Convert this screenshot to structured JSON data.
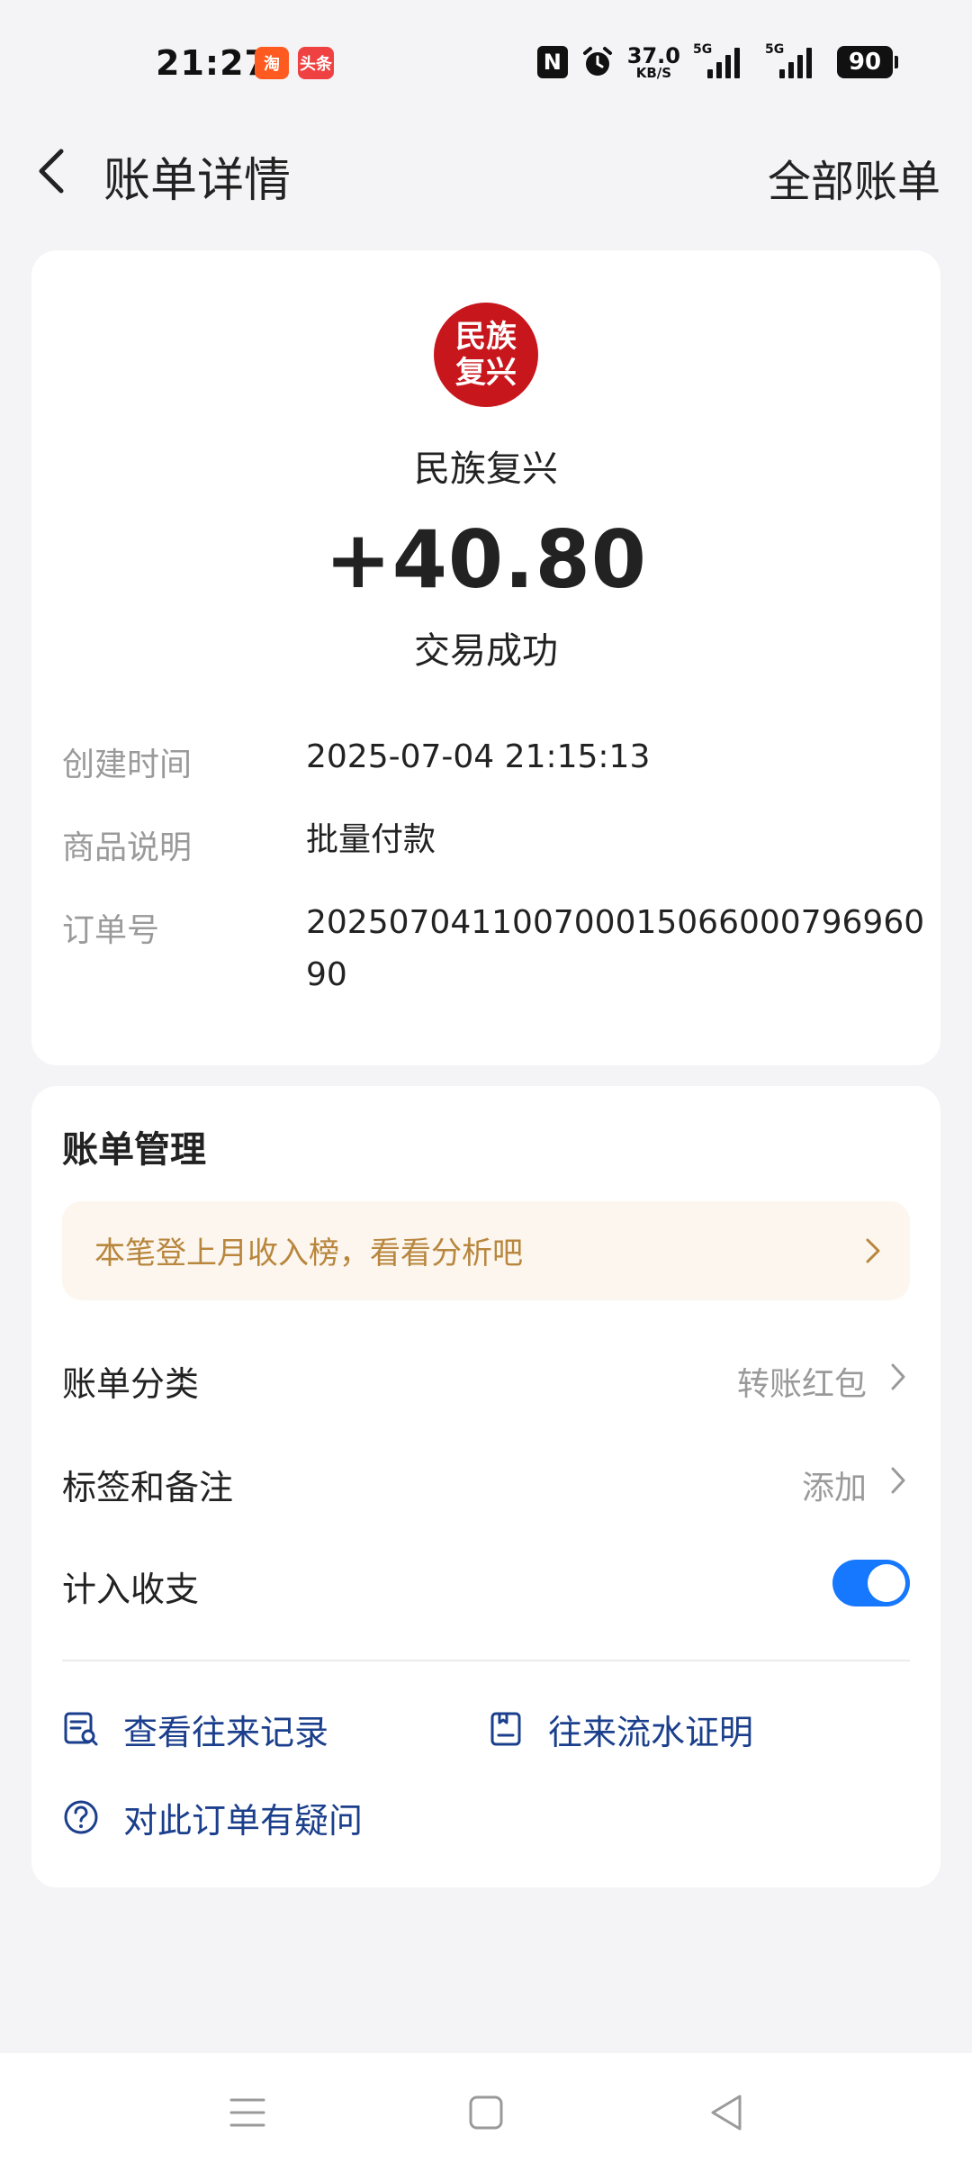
{
  "status_bar": {
    "time": "21:27",
    "app_badges": [
      "淘",
      "头条"
    ],
    "net_speed_value": "37.0",
    "net_speed_unit": "KB/S",
    "signal1_label": "5G",
    "signal2_label": "5G",
    "battery": "90"
  },
  "header": {
    "title": "账单详情",
    "all_bills": "全部账单"
  },
  "transaction": {
    "avatar_text": "民族复兴",
    "merchant": "民族复兴",
    "amount": "+40.80",
    "status": "交易成功",
    "details": [
      {
        "label": "创建时间",
        "value": "2025-07-04 21:15:13"
      },
      {
        "label": "商品说明",
        "value": "批量付款"
      },
      {
        "label": "订单号",
        "value": "20250704110070001506600079696090"
      }
    ]
  },
  "manage": {
    "title": "账单管理",
    "promo": "本笔登上月收入榜，看看分析吧",
    "category_label": "账单分类",
    "category_value": "转账红包",
    "tags_label": "标签和备注",
    "tags_value": "添加",
    "include_label": "计入收支",
    "include_on": true,
    "links": [
      {
        "label": "查看往来记录",
        "icon": "record-search-icon"
      },
      {
        "label": "往来流水证明",
        "icon": "statement-icon"
      },
      {
        "label": "对此订单有疑问",
        "icon": "question-icon"
      }
    ]
  },
  "colors": {
    "accent": "#1677ff",
    "link": "#1b3f8c",
    "promo_text": "#b8863d",
    "avatar": "#c8161d"
  }
}
